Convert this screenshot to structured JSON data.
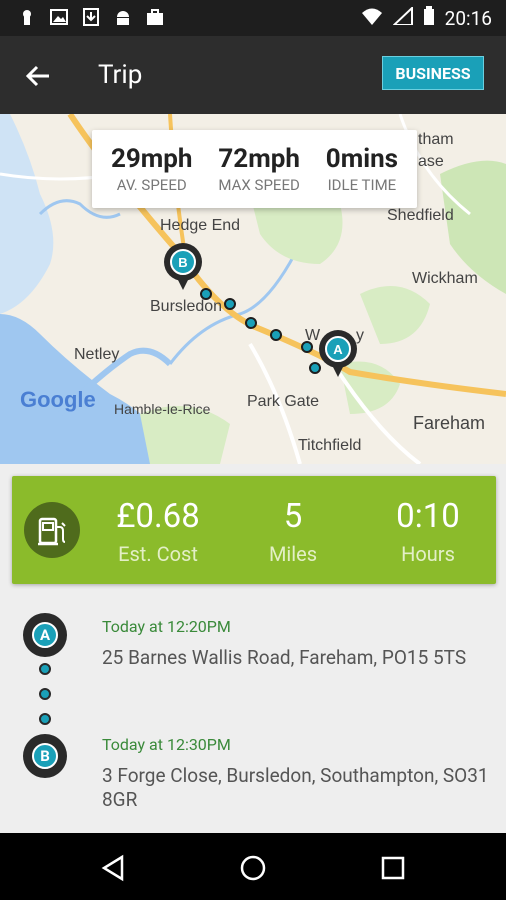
{
  "status_bar": {
    "time": "20:16",
    "icons": [
      "keyhole-icon",
      "image-icon",
      "download-icon",
      "android-icon",
      "briefcase-icon",
      "wifi-icon",
      "signal-icon",
      "battery-icon"
    ]
  },
  "app_bar": {
    "title": "Trip",
    "business_label": "BUSINESS"
  },
  "map": {
    "place_labels": [
      "Hedge End",
      "Bursledon",
      "Netley",
      "Hamble-le-Rice",
      "Park Gate",
      "Titchfield",
      "Fareham",
      "Wickham",
      "Shedfield",
      "tham",
      "ase",
      "W",
      "y"
    ],
    "attribution": "Google"
  },
  "speed_card": {
    "items": [
      {
        "value": "29mph",
        "label": "AV. SPEED"
      },
      {
        "value": "72mph",
        "label": "MAX SPEED"
      },
      {
        "value": "0mins",
        "label": "IDLE TIME"
      }
    ]
  },
  "summary": {
    "cost": {
      "value": "£0.68",
      "label": "Est. Cost"
    },
    "miles": {
      "value": "5",
      "label": "Miles"
    },
    "hours": {
      "value": "0:10",
      "label": "Hours"
    }
  },
  "trip": {
    "start": {
      "marker": "A",
      "time": "Today at 12:20PM",
      "address": "25 Barnes Wallis Road, Fareham, PO15 5TS"
    },
    "end": {
      "marker": "B",
      "time": "Today at 12:30PM",
      "address": "3 Forge Close, Bursledon, Southampton, SO31 8GR"
    }
  },
  "colors": {
    "accent": "#1aa0b8",
    "summary_green": "#8bbb2b",
    "time_green": "#3a8a3a",
    "app_bar": "#2d2d2d"
  }
}
